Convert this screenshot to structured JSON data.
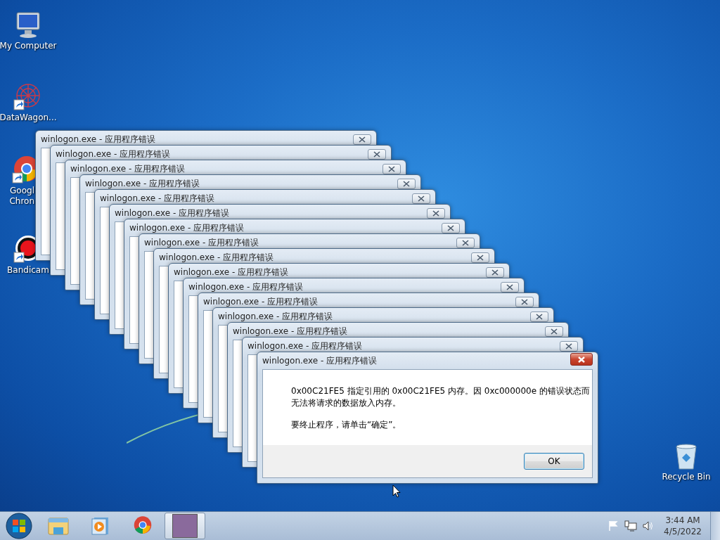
{
  "desktop_icons": [
    {
      "kind": "computer",
      "lines": [
        "My Computer"
      ],
      "shortcut": false
    },
    {
      "kind": "network",
      "lines": [
        "DataWagon..."
      ],
      "shortcut": true
    },
    {
      "kind": "chrome",
      "lines": [
        "Googl",
        "Chron"
      ],
      "shortcut": true
    },
    {
      "kind": "bandicam",
      "lines": [
        "Bandicam"
      ],
      "shortcut": true
    },
    {
      "kind": "recycle",
      "lines": [
        "Recycle Bin"
      ],
      "shortcut": false
    }
  ],
  "background_windows": [
    {
      "title": "winlogon.exe - 应用程序错误"
    },
    {
      "title": "winlogon.exe - 应用程序错误"
    },
    {
      "title": "winlogon.exe - 应用程序错误"
    },
    {
      "title": "winlogon.exe - 应用程序错误"
    },
    {
      "title": "winlogon.exe - 应用程序错误"
    },
    {
      "title": "winlogon.exe - 应用程序错误"
    },
    {
      "title": "winlogon.exe - 应用程序错误"
    },
    {
      "title": "winlogon.exe - 应用程序错误"
    },
    {
      "title": "winlogon.exe - 应用程序错误"
    },
    {
      "title": "winlogon.exe - 应用程序错误"
    },
    {
      "title": "winlogon.exe - 应用程序错误"
    },
    {
      "title": "winlogon.exe - 应用程序错误"
    },
    {
      "title": "winlogon.exe - 应用程序错误"
    },
    {
      "title": "winlogon.exe - 应用程序错误"
    },
    {
      "title": "winlogon.exe - 应用程序错误"
    }
  ],
  "dialog": {
    "title": "winlogon.exe - 应用程序错误",
    "message_lines": [
      "0x00C21FE5 指定引用的 0x00C21FE5 内存。因 0xc000000e 的错误状态而",
      "无法将请求的数据放入内存。"
    ],
    "prompt": "要终止程序，请单击“确定”。",
    "button": "OK"
  },
  "taskbar": {
    "items": [
      {
        "kind": "explorer",
        "selected": false
      },
      {
        "kind": "media",
        "selected": false
      },
      {
        "kind": "chrome",
        "selected": false
      },
      {
        "kind": "app",
        "selected": true
      }
    ],
    "clock": {
      "time": "3:44 AM",
      "date": "4/5/2022"
    }
  }
}
